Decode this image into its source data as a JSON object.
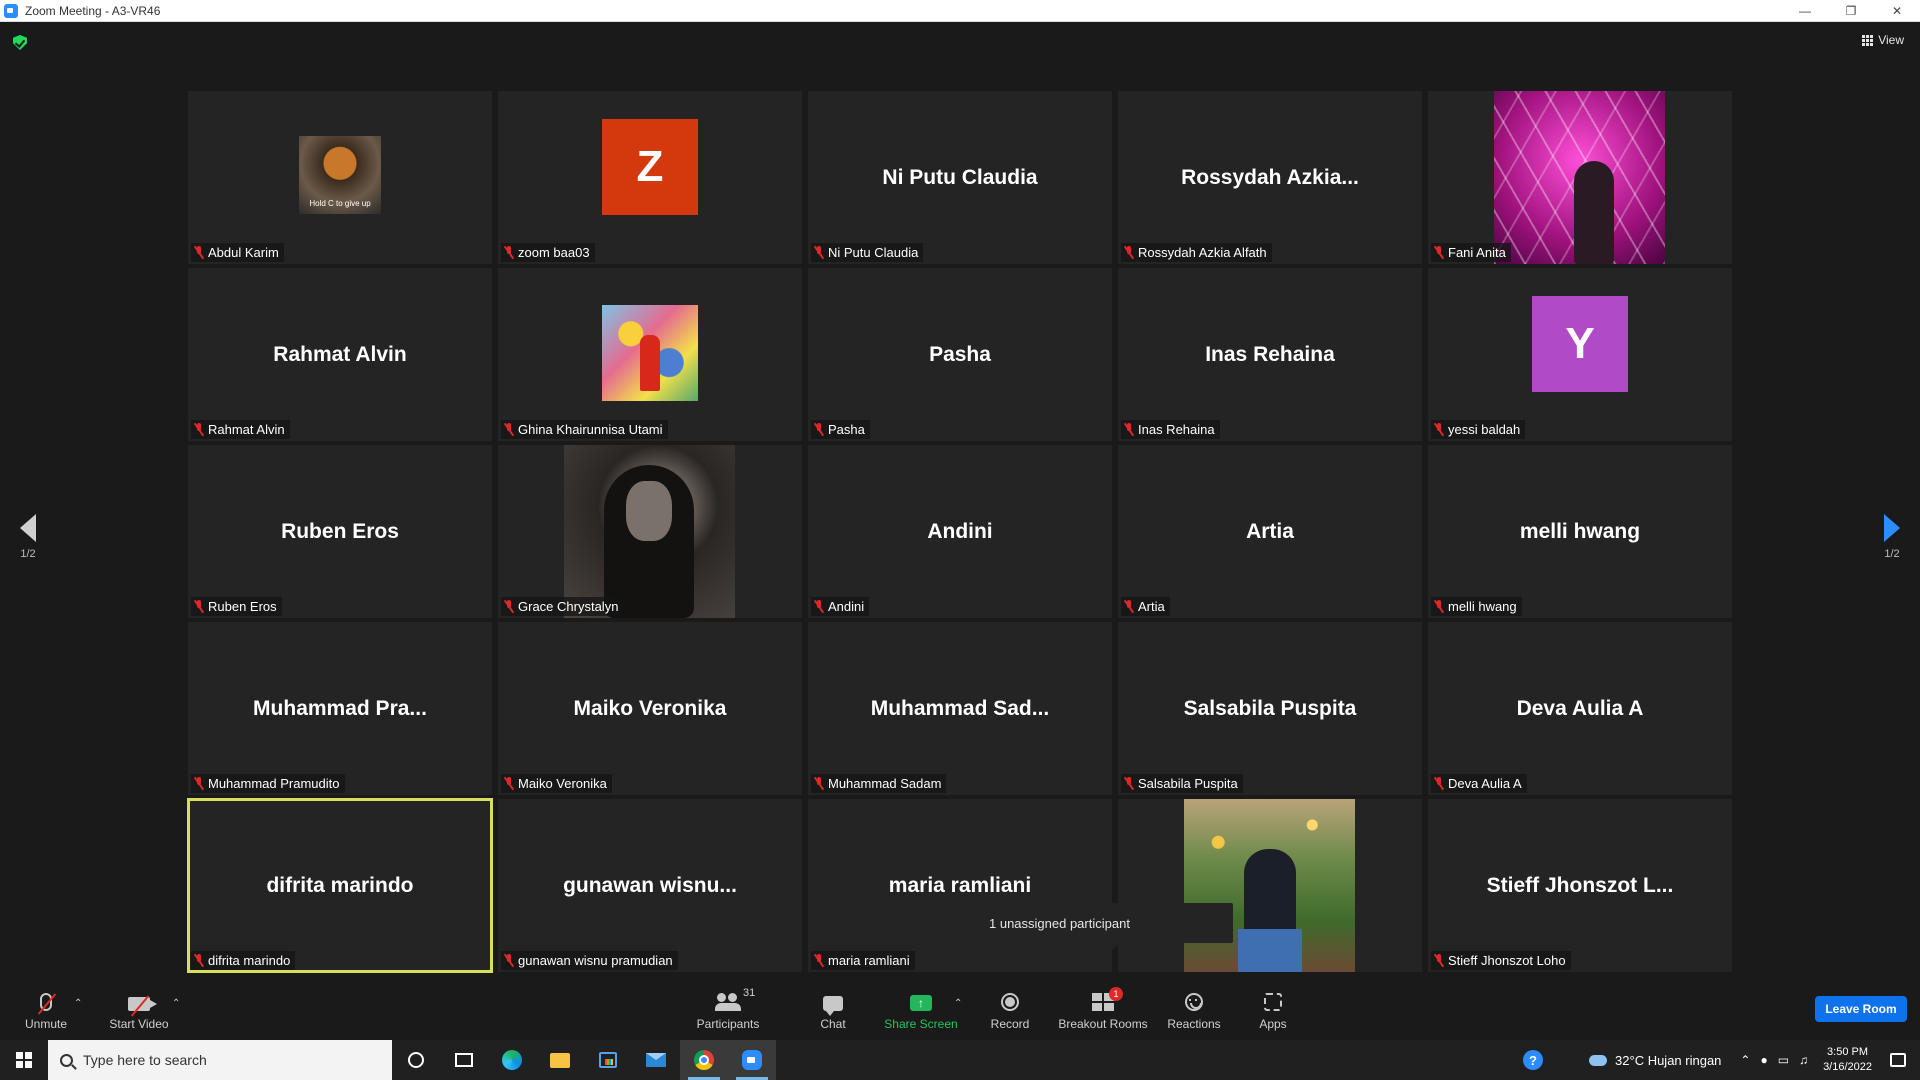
{
  "window": {
    "title": "Zoom Meeting - A3-VR46"
  },
  "view_button": {
    "label": "View"
  },
  "pagination": {
    "left_label": "1/2",
    "right_label": "1/2"
  },
  "tiles": [
    {
      "big": "",
      "label": "Abdul Karim",
      "video": "abdul",
      "hold": "Hold C to give up"
    },
    {
      "big": "",
      "label": "zoom baa03",
      "avatar_letter": "Z",
      "avatar_color": "#d4380d"
    },
    {
      "big": "Ni Putu Claudia",
      "label": "Ni Putu Claudia"
    },
    {
      "big": "Rossydah  Azkia...",
      "label": "Rossydah Azkia Alfath"
    },
    {
      "big": "",
      "label": "Fani Anita",
      "video": "fani"
    },
    {
      "big": "Rahmat Alvin",
      "label": "Rahmat Alvin"
    },
    {
      "big": "",
      "label": "Ghina Khairunnisa Utami",
      "video": "ghina"
    },
    {
      "big": "Pasha",
      "label": "Pasha"
    },
    {
      "big": "Inas Rehaina",
      "label": "Inas Rehaina"
    },
    {
      "big": "",
      "label": "yessi baldah",
      "avatar_letter": "Y",
      "avatar_color": "#b04ac7"
    },
    {
      "big": "Ruben Eros",
      "label": "Ruben Eros"
    },
    {
      "big": "",
      "label": "Grace Chrystalyn",
      "video": "grace"
    },
    {
      "big": "Andini",
      "label": "Andini"
    },
    {
      "big": "Artia",
      "label": "Artia"
    },
    {
      "big": "melli hwang",
      "label": "melli hwang"
    },
    {
      "big": "Muhammad  Pra...",
      "label": "Muhammad Pramudito"
    },
    {
      "big": "Maiko Veronika",
      "label": "Maiko Veronika"
    },
    {
      "big": "Muhammad  Sad...",
      "label": "Muhammad Sadam"
    },
    {
      "big": "Salsabila Puspita",
      "label": "Salsabila Puspita"
    },
    {
      "big": "Deva Aulia A",
      "label": "Deva Aulia A"
    },
    {
      "big": "difrita marindo",
      "label": "difrita marindo",
      "active": true
    },
    {
      "big": "gunawan  wisnu...",
      "label": "gunawan wisnu pramudian"
    },
    {
      "big": "maria ramliani",
      "label": "maria ramliani"
    },
    {
      "big": "",
      "label": "",
      "video": "carnival"
    },
    {
      "big": "Stieff  Jhonszot  L...",
      "label": "Stieff Jhonszot Loho"
    }
  ],
  "tooltip": {
    "text": "1 unassigned participant"
  },
  "toolbar": {
    "unmute": "Unmute",
    "start_video": "Start Video",
    "participants": "Participants",
    "participants_count": "31",
    "chat": "Chat",
    "share_screen": "Share Screen",
    "record": "Record",
    "breakout_rooms": "Breakout Rooms",
    "breakout_badge": "1",
    "reactions": "Reactions",
    "apps": "Apps",
    "leave": "Leave Room"
  },
  "taskbar": {
    "search_placeholder": "Type here to search",
    "weather": "32°C  Hujan ringan",
    "time": "3:50 PM",
    "date": "3/16/2022"
  },
  "colors": {
    "accent": "#2d8cff",
    "active_border": "#d6e05a",
    "share_green": "#22b85a",
    "leave_blue": "#0e72ed"
  }
}
